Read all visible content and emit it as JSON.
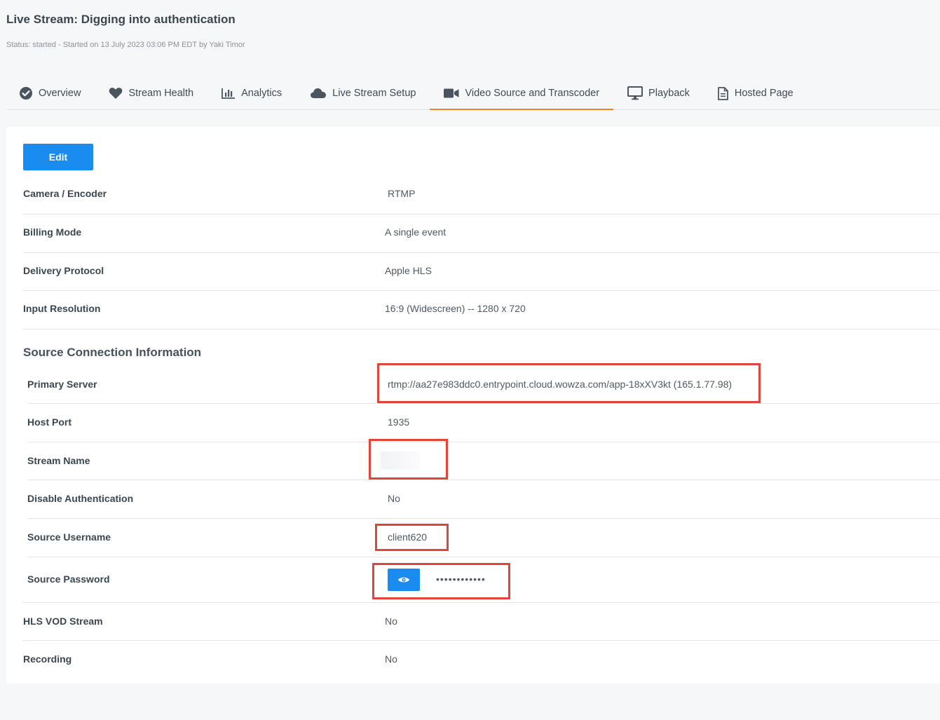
{
  "header": {
    "title": "Live Stream: Digging into authentication",
    "status": "Status: started - Started on 13 July 2023 03:06 PM EDT by Yaki Timor"
  },
  "tabs": [
    {
      "label": "Overview",
      "icon": "check-circle-icon",
      "active": false
    },
    {
      "label": "Stream Health",
      "icon": "heart-icon",
      "active": false
    },
    {
      "label": "Analytics",
      "icon": "bar-chart-icon",
      "active": false
    },
    {
      "label": "Live Stream Setup",
      "icon": "cloud-icon",
      "active": false
    },
    {
      "label": "Video Source and Transcoder",
      "icon": "video-camera-icon",
      "active": true
    },
    {
      "label": "Playback",
      "icon": "monitor-icon",
      "active": false
    },
    {
      "label": "Hosted Page",
      "icon": "document-icon",
      "active": false
    }
  ],
  "toolbar": {
    "edit_label": "Edit"
  },
  "details": {
    "camera": {
      "label": "Camera / Encoder",
      "value": "RTMP"
    },
    "billing": {
      "label": "Billing Mode",
      "value": "A single event"
    },
    "protocol": {
      "label": "Delivery Protocol",
      "value": "Apple HLS"
    },
    "resolution": {
      "label": "Input Resolution",
      "value": "16:9 (Widescreen) -- 1280 x 720"
    }
  },
  "source": {
    "title": "Source Connection Information",
    "primary_server": {
      "label": "Primary Server",
      "value": "rtmp://aa27e983ddc0.entrypoint.cloud.wowza.com/app-18xXV3kt (165.1.77.98)"
    },
    "host_port": {
      "label": "Host Port",
      "value": "1935"
    },
    "stream_name": {
      "label": "Stream Name",
      "value": ""
    },
    "disable_auth": {
      "label": "Disable Authentication",
      "value": "No"
    },
    "username": {
      "label": "Source Username",
      "value": "client620"
    },
    "password": {
      "label": "Source Password",
      "value": "••••••••••••"
    }
  },
  "extra": {
    "hls_vod": {
      "label": "HLS VOD Stream",
      "value": "No"
    },
    "recording": {
      "label": "Recording",
      "value": "No"
    }
  },
  "colors": {
    "accent": "#1a8cf0",
    "active_tab": "#f5821f",
    "highlight": "#e0453a"
  }
}
